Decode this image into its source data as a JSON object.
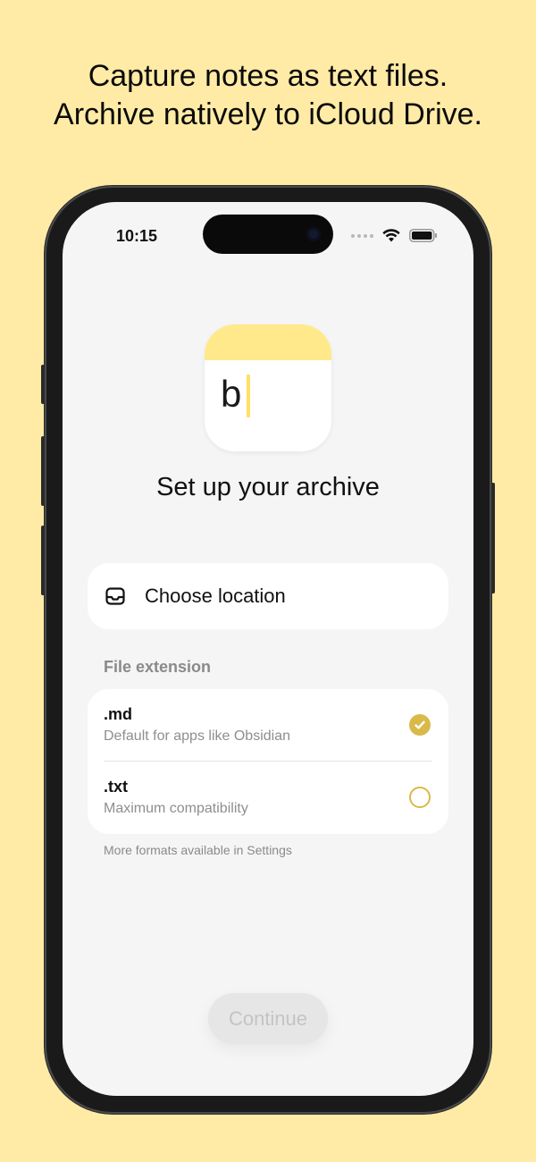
{
  "headline": {
    "line1": "Capture notes as text files.",
    "line2": "Archive natively to iCloud Drive."
  },
  "status_bar": {
    "time": "10:15",
    "icons": [
      "cellular-dots-icon",
      "wifi-icon",
      "battery-icon"
    ]
  },
  "app_icon": {
    "letter": "b",
    "band_color": "#FFE98A",
    "cursor_color": "#FFE066"
  },
  "setup": {
    "title": "Set up your archive"
  },
  "location": {
    "icon": "inbox-tray-icon",
    "label": "Choose location"
  },
  "file_extension": {
    "header": "File extension",
    "options": [
      {
        "name": ".md",
        "description": "Default for apps like Obsidian",
        "selected": true
      },
      {
        "name": ".txt",
        "description": "Maximum compatibility",
        "selected": false
      }
    ],
    "footnote": "More formats available in Settings"
  },
  "continue_button": {
    "label": "Continue",
    "enabled": false
  },
  "colors": {
    "background": "#FFEBA6",
    "accent": "#D9B94A",
    "screen": "#F5F5F5"
  }
}
